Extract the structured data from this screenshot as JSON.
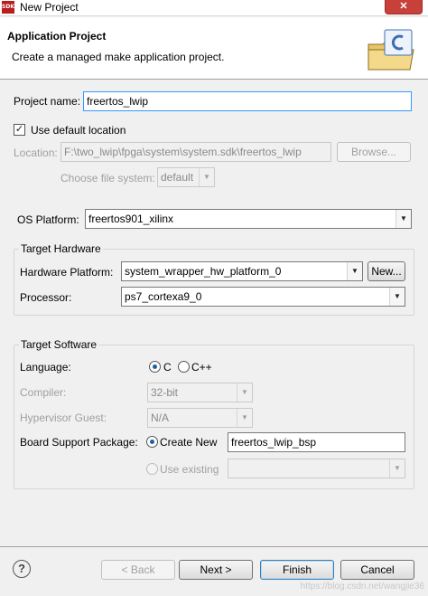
{
  "window": {
    "icon_text": "SDK",
    "title": "New Project",
    "close_glyph": "✕"
  },
  "header": {
    "title": "Application Project",
    "description": "Create a managed make application project."
  },
  "form": {
    "project_name_label": "Project name:",
    "project_name_value": "freertos_lwip",
    "use_default_location_label": "Use default location",
    "use_default_location_checked": true,
    "location_label": "Location:",
    "location_value": "F:\\two_lwip\\fpga\\system\\system.sdk\\freertos_lwip",
    "browse_label": "Browse...",
    "file_system_label": "Choose file system:",
    "file_system_value": "default",
    "os_platform_label": "OS Platform:",
    "os_platform_value": "freertos901_xilinx"
  },
  "target_hardware": {
    "title": "Target Hardware",
    "hardware_platform_label": "Hardware Platform:",
    "hardware_platform_value": "system_wrapper_hw_platform_0",
    "new_button_label": "New...",
    "processor_label": "Processor:",
    "processor_value": "ps7_cortexa9_0"
  },
  "target_software": {
    "title": "Target Software",
    "language_label": "Language:",
    "language_options": [
      "C",
      "C++"
    ],
    "language_selected": "C",
    "compiler_label": "Compiler:",
    "compiler_value": "32-bit",
    "hypervisor_label": "Hypervisor Guest:",
    "hypervisor_value": "N/A",
    "bsp_label": "Board Support Package:",
    "create_new_label": "Create New",
    "create_new_value": "freertos_lwip_bsp",
    "use_existing_label": "Use existing",
    "use_existing_value": ""
  },
  "footer": {
    "help_glyph": "?",
    "back_label": "< Back",
    "next_label": "Next >",
    "finish_label": "Finish",
    "cancel_label": "Cancel",
    "watermark": "https://blog.csdn.net/wangjie36"
  },
  "colors": {
    "accent": "#3399ff",
    "close_button": "#c7413a",
    "icon_red": "#b81e1e"
  }
}
